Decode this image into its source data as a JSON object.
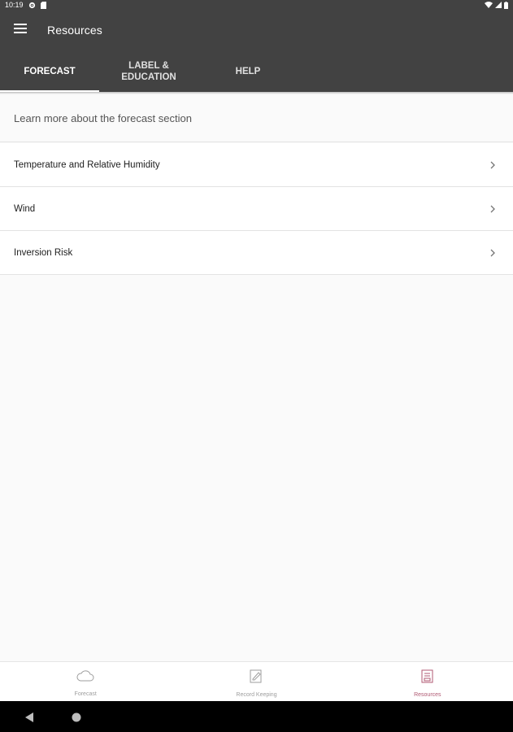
{
  "status_bar": {
    "time": "10:19"
  },
  "app_bar": {
    "title": "Resources"
  },
  "tabs": [
    {
      "label": "FORECAST",
      "active": true
    },
    {
      "label": "LABEL &\nEDUCATION",
      "active": false
    },
    {
      "label": "HELP",
      "active": false
    }
  ],
  "section_header": "Learn more about the forecast section",
  "items": [
    {
      "label": "Temperature and Relative Humidity"
    },
    {
      "label": "Wind"
    },
    {
      "label": "Inversion Risk"
    }
  ],
  "bottom_nav": [
    {
      "label": "Forecast",
      "icon": "cloud-icon",
      "active": false
    },
    {
      "label": "Record Keeping",
      "icon": "edit-note-icon",
      "active": false
    },
    {
      "label": "Resources",
      "icon": "book-icon",
      "active": true
    }
  ],
  "colors": {
    "app_bar": "#424242",
    "accent": "#b05a73",
    "background": "#fafafa"
  }
}
